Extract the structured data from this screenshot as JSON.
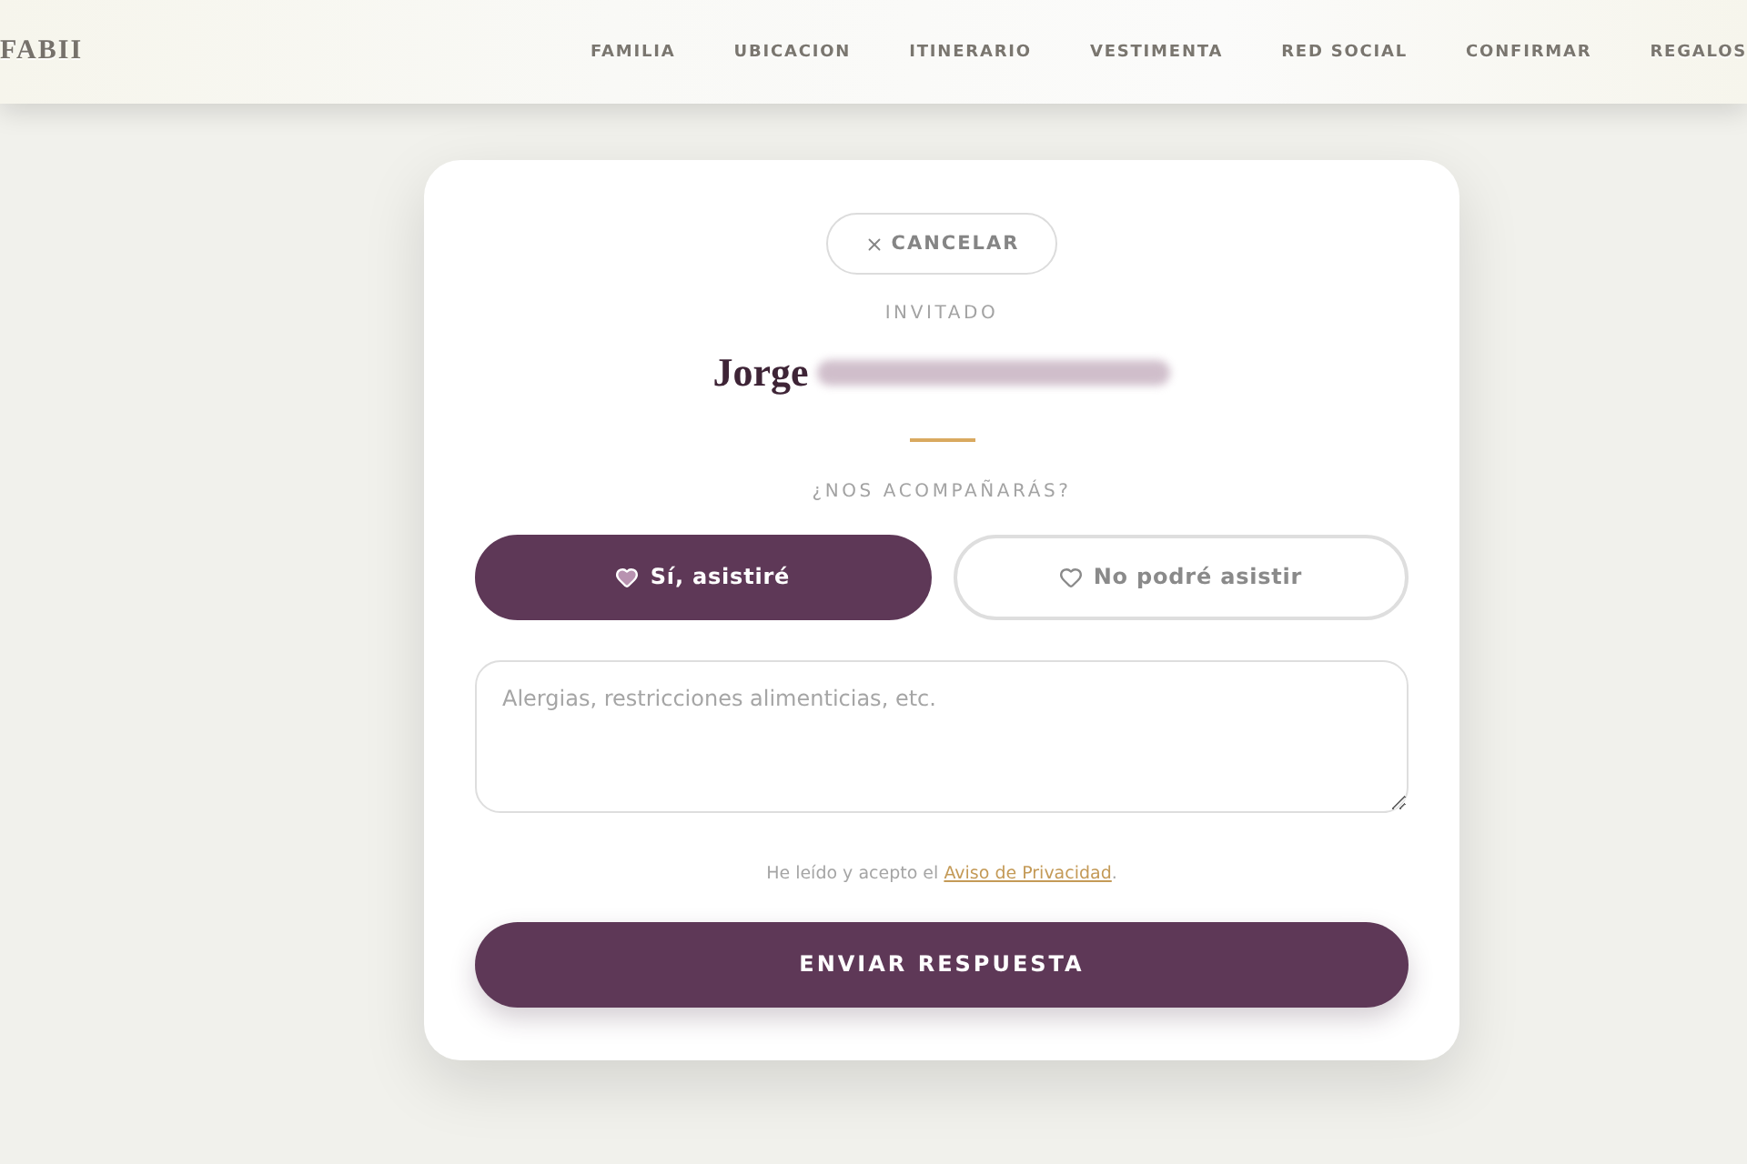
{
  "header": {
    "logo": "FABII",
    "nav": [
      {
        "label": "FAMILIA"
      },
      {
        "label": "UBICACION"
      },
      {
        "label": "ITINERARIO"
      },
      {
        "label": "VESTIMENTA"
      },
      {
        "label": "RED SOCIAL"
      },
      {
        "label": "CONFIRMAR"
      },
      {
        "label": "REGALOS"
      }
    ]
  },
  "rsvp": {
    "cancel": {
      "label": "CANCELAR"
    },
    "guest_label": "INVITADO",
    "guest_name": "Jorge",
    "question": "¿NOS ACOMPAÑARÁS?",
    "options": [
      {
        "label": "Sí, asistiré",
        "selected": true
      },
      {
        "label": "No podré asistir",
        "selected": false
      }
    ],
    "notes": {
      "placeholder": "Alergias, restricciones alimenticias, etc."
    },
    "consent": {
      "text": "He leído y acepto el",
      "link": "Aviso de Privacidad",
      "end": "."
    },
    "submit": {
      "label": "ENVIAR RESPUESTA"
    }
  }
}
